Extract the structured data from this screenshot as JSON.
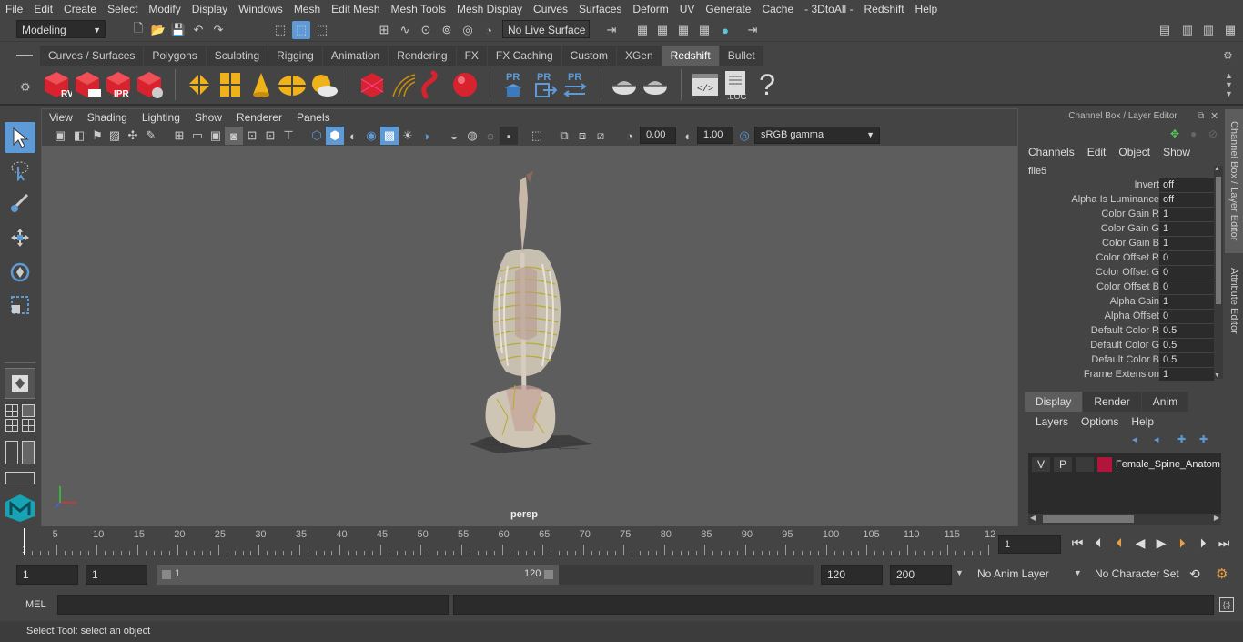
{
  "menubar": [
    "File",
    "Edit",
    "Create",
    "Select",
    "Modify",
    "Display",
    "Windows",
    "Mesh",
    "Edit Mesh",
    "Mesh Tools",
    "Mesh Display",
    "Curves",
    "Surfaces",
    "Deform",
    "UV",
    "Generate",
    "Cache",
    "- 3DtoAll -",
    "Redshift",
    "Help"
  ],
  "statusline": {
    "mode": "Modeling",
    "live_surface": "No Live Surface"
  },
  "shelf_tabs": [
    "Curves / Surfaces",
    "Polygons",
    "Sculpting",
    "Rigging",
    "Animation",
    "Rendering",
    "FX",
    "FX Caching",
    "Custom",
    "XGen",
    "Redshift",
    "Bullet"
  ],
  "shelf_active": "Redshift",
  "shelf_icon_labels": {
    "rv": "RV",
    "ipr": "IPR",
    "pr1": "PR",
    "pr2": "PR",
    "pr3": "PR",
    "log": ".LOG",
    "help": "?"
  },
  "viewport": {
    "menu": [
      "View",
      "Shading",
      "Lighting",
      "Show",
      "Renderer",
      "Panels"
    ],
    "exposure": "0.00",
    "gamma": "1.00",
    "color_space": "sRGB gamma",
    "camera": "persp"
  },
  "channel_box": {
    "title": "Channel Box / Layer Editor",
    "menu": [
      "Channels",
      "Edit",
      "Object",
      "Show"
    ],
    "node": "file5",
    "attrs": [
      {
        "name": "Invert",
        "value": "off"
      },
      {
        "name": "Alpha Is Luminance",
        "value": "off"
      },
      {
        "name": "Color Gain R",
        "value": "1"
      },
      {
        "name": "Color Gain G",
        "value": "1"
      },
      {
        "name": "Color Gain B",
        "value": "1"
      },
      {
        "name": "Color Offset R",
        "value": "0"
      },
      {
        "name": "Color Offset G",
        "value": "0"
      },
      {
        "name": "Color Offset B",
        "value": "0"
      },
      {
        "name": "Alpha Gain",
        "value": "1"
      },
      {
        "name": "Alpha Offset",
        "value": "0"
      },
      {
        "name": "Default Color R",
        "value": "0.5"
      },
      {
        "name": "Default Color G",
        "value": "0.5"
      },
      {
        "name": "Default Color B",
        "value": "0.5"
      },
      {
        "name": "Frame Extension",
        "value": "1"
      }
    ]
  },
  "layer_editor": {
    "tabs": [
      "Display",
      "Render",
      "Anim"
    ],
    "active_tab": "Display",
    "menu": [
      "Layers",
      "Options",
      "Help"
    ],
    "layer": {
      "v": "V",
      "p": "P",
      "name": "Female_Spine_Anatom",
      "color": "#b0163a"
    }
  },
  "side_tabs": [
    "Channel Box / Layer Editor",
    "Attribute Editor"
  ],
  "timeline": {
    "ticks": [
      "5",
      "10",
      "15",
      "20",
      "25",
      "30",
      "35",
      "40",
      "45",
      "50",
      "55",
      "60",
      "65",
      "70",
      "75",
      "80",
      "85",
      "90",
      "95",
      "100",
      "105",
      "110",
      "115",
      "12"
    ],
    "start_label": "1",
    "current_frame": "1"
  },
  "range": {
    "start": "1",
    "start2": "1",
    "slider_start": "1",
    "slider_end": "120",
    "end": "120",
    "end2": "200",
    "anim_layer": "No Anim Layer",
    "char_set": "No Character Set"
  },
  "command": {
    "lang": "MEL"
  },
  "help_line": "Select Tool: select an object",
  "colors": {
    "accent": "#5e9bd6",
    "redshift_red": "#d8232e",
    "gold": "#f0b21a"
  }
}
